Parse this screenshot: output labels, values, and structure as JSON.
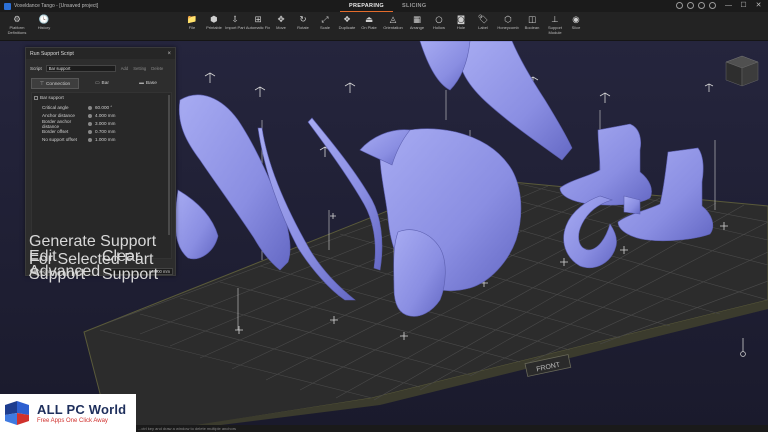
{
  "window": {
    "title": "Voxeldance Tango - [Unsaved project]",
    "mode_tabs": [
      "PREPARING",
      "SLICING"
    ],
    "active_mode": "PREPARING",
    "accent": "#e46c2c"
  },
  "left_tools": [
    {
      "label": "Platform Definitions",
      "icon": "platform-icon",
      "glyph": "⚙"
    },
    {
      "label": "History",
      "icon": "history-icon",
      "glyph": "🕓"
    }
  ],
  "toolbar": [
    {
      "label": "File",
      "icon": "folder-icon",
      "glyph": "📁"
    },
    {
      "label": "Printable",
      "icon": "cube-icon",
      "glyph": "⬢"
    },
    {
      "label": "Import Part",
      "icon": "import-icon",
      "glyph": "⇩"
    },
    {
      "label": "Automatic Fix",
      "icon": "autofix-icon",
      "glyph": "⊞"
    },
    {
      "label": "Move",
      "icon": "move-icon",
      "glyph": "✥"
    },
    {
      "label": "Rotate",
      "icon": "rotate-icon",
      "glyph": "↻"
    },
    {
      "label": "Scale",
      "icon": "scale-icon",
      "glyph": "⤢"
    },
    {
      "label": "Duplicate",
      "icon": "duplicate-icon",
      "glyph": "❖"
    },
    {
      "label": "On Plate",
      "icon": "on-plate-icon",
      "glyph": "⏏"
    },
    {
      "label": "Orientation",
      "icon": "orientation-icon",
      "glyph": "◬"
    },
    {
      "label": "Arrange",
      "icon": "arrange-icon",
      "glyph": "▦"
    },
    {
      "label": "Hollow",
      "icon": "hollow-icon",
      "glyph": "○"
    },
    {
      "label": "Hole",
      "icon": "hole-icon",
      "glyph": "◙"
    },
    {
      "label": "Label",
      "icon": "label-icon",
      "glyph": "🏷"
    },
    {
      "label": "Honeycomb",
      "icon": "honeycomb-icon",
      "glyph": "⬡"
    },
    {
      "label": "Boolean",
      "icon": "boolean-icon",
      "glyph": "◫"
    },
    {
      "label": "Support Module",
      "icon": "support-icon",
      "glyph": "⊥"
    },
    {
      "label": "Slice",
      "icon": "slice-icon",
      "glyph": "◉"
    }
  ],
  "support_panel": {
    "title": "Run Support Script",
    "script_label": "Script",
    "script_value": "Bar support",
    "links": [
      "Add",
      "Setting",
      "Delete"
    ],
    "tabs": [
      {
        "label": "Connection",
        "icon": "connection-icon",
        "glyph": "⊤"
      },
      {
        "label": "Bar",
        "icon": "bar-icon",
        "glyph": "▭"
      },
      {
        "label": "Base",
        "icon": "base-icon",
        "glyph": "▬"
      }
    ],
    "active_tab": "Connection",
    "list_header": "Bar support",
    "params": [
      {
        "name": "Critical angle",
        "value": "60.000 °"
      },
      {
        "name": "Anchor distance",
        "value": "4.000 mm"
      },
      {
        "name": "Border anchor distance",
        "value": "3.000 mm"
      },
      {
        "name": "Border offset",
        "value": "0.700 mm"
      },
      {
        "name": "No support offset",
        "value": "1.000 mm"
      }
    ],
    "lift_label": "Lift height",
    "lift_value": "0.000 mm",
    "buttons": {
      "generate": "Generate Support For Selected Part",
      "edit": "Edit Support",
      "clear": "Clear Support",
      "advanced": "Advanced"
    }
  },
  "viewport": {
    "plate_label": "FRONT",
    "model_color": "#8f93e8",
    "grid_color": "#4c4c4c"
  },
  "watermark": {
    "title": "ALL PC World",
    "subtitle": "Free Apps One Click Away"
  },
  "status": {
    "text": "...ctrl key and draw a window to delete multiple anchors"
  }
}
